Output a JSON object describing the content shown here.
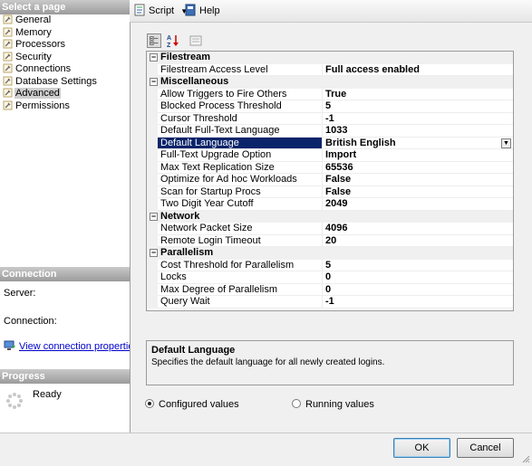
{
  "left_pane": {
    "select_page_header": "Select a page",
    "pages": [
      {
        "label": "General",
        "selected": false
      },
      {
        "label": "Memory",
        "selected": false
      },
      {
        "label": "Processors",
        "selected": false
      },
      {
        "label": "Security",
        "selected": false
      },
      {
        "label": "Connections",
        "selected": false
      },
      {
        "label": "Database Settings",
        "selected": false
      },
      {
        "label": "Advanced",
        "selected": true
      },
      {
        "label": "Permissions",
        "selected": false
      }
    ],
    "connection_header": "Connection",
    "server_label": "Server:",
    "connection_label": "Connection:",
    "view_connection_link": "View connection properties",
    "progress_header": "Progress",
    "progress_status": "Ready"
  },
  "toolbar": {
    "script_label": "Script",
    "help_label": "Help"
  },
  "property_grid": {
    "rows": [
      {
        "kind": "category",
        "name": "Filestream"
      },
      {
        "kind": "property",
        "name": "Filestream Access Level",
        "value": "Full access enabled"
      },
      {
        "kind": "category",
        "name": "Miscellaneous"
      },
      {
        "kind": "property",
        "name": "Allow Triggers to Fire Others",
        "value": "True"
      },
      {
        "kind": "property",
        "name": "Blocked Process Threshold",
        "value": "5"
      },
      {
        "kind": "property",
        "name": "Cursor Threshold",
        "value": "-1"
      },
      {
        "kind": "property",
        "name": "Default Full-Text Language",
        "value": "1033"
      },
      {
        "kind": "property",
        "name": "Default Language",
        "value": "British English",
        "selected": true
      },
      {
        "kind": "property",
        "name": "Full-Text Upgrade Option",
        "value": "Import"
      },
      {
        "kind": "property",
        "name": "Max Text Replication Size",
        "value": "65536"
      },
      {
        "kind": "property",
        "name": "Optimize for Ad hoc Workloads",
        "value": "False"
      },
      {
        "kind": "property",
        "name": "Scan for Startup Procs",
        "value": "False"
      },
      {
        "kind": "property",
        "name": "Two Digit Year Cutoff",
        "value": "2049"
      },
      {
        "kind": "category",
        "name": "Network"
      },
      {
        "kind": "property",
        "name": "Network Packet Size",
        "value": "4096"
      },
      {
        "kind": "property",
        "name": "Remote Login Timeout",
        "value": "20"
      },
      {
        "kind": "category",
        "name": "Parallelism"
      },
      {
        "kind": "property",
        "name": "Cost Threshold for Parallelism",
        "value": "5"
      },
      {
        "kind": "property",
        "name": "Locks",
        "value": "0"
      },
      {
        "kind": "property",
        "name": "Max Degree of Parallelism",
        "value": "0"
      },
      {
        "kind": "property",
        "name": "Query Wait",
        "value": "-1"
      }
    ]
  },
  "description": {
    "title": "Default Language",
    "text": "Specifies the default language for all newly created logins."
  },
  "view_options": {
    "configured_label": "Configured values",
    "running_label": "Running values",
    "selected": "configured"
  },
  "buttons": {
    "ok_label": "OK",
    "cancel_label": "Cancel"
  },
  "colors": {
    "selected_row": "#0a246a",
    "section_header": "#9b9b9b",
    "link": "#0000cc"
  }
}
